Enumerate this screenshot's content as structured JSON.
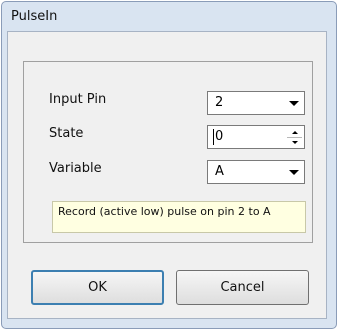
{
  "window": {
    "title": "PulseIn"
  },
  "form": {
    "input_pin": {
      "label": "Input Pin",
      "value": "2"
    },
    "state": {
      "label": "State",
      "value": "0"
    },
    "variable": {
      "label": "Variable",
      "value": "A"
    },
    "description": "Record (active low) pulse on pin 2 to A"
  },
  "buttons": {
    "ok_label": "OK",
    "cancel_label": "Cancel"
  },
  "icons": {
    "dropdown": "chevron-down-icon",
    "spin_up": "spin-up-icon",
    "spin_down": "spin-down-icon"
  }
}
